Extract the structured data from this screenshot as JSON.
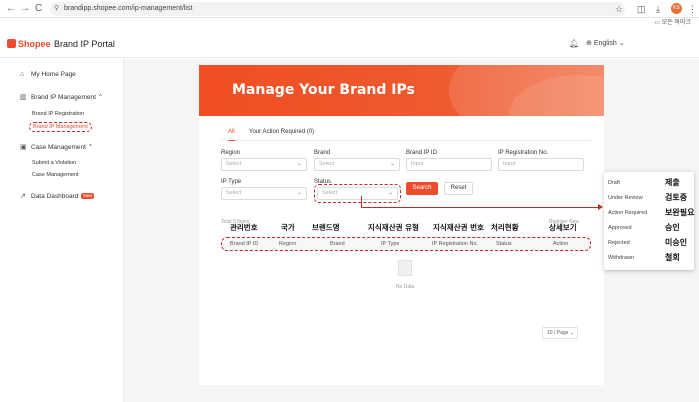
{
  "browser": {
    "url": "brandipp.shopee.com/ip-management/list",
    "back": "←",
    "forward": "→",
    "reload": "C",
    "avatar_text": "KS",
    "bookmarks_label": "모든 북마크"
  },
  "header": {
    "logo": "Shopee",
    "title": "Brand IP Portal",
    "language": "English"
  },
  "sidebar": {
    "home": "My Home Page",
    "brand_ip_management": "Brand IP Management",
    "brand_ip_registration": "Brand IP Registration",
    "brand_ip_list": "Brand IP Management",
    "case_management": "Case Management",
    "submit_violation": "Submit a Violation",
    "case_management_sub": "Case Management",
    "data_dashboard": "Data Dashboard",
    "new_badge": "New"
  },
  "main": {
    "banner_title": "Manage Your Brand IPs",
    "tabs": [
      "All",
      "Your Action Required (0)"
    ],
    "filters": {
      "region_label": "Region",
      "region_placeholder": "Select",
      "brand_label": "Brand",
      "brand_placeholder": "Select",
      "brand_ip_id_label": "Brand IP ID",
      "brand_ip_id_placeholder": "Input",
      "ip_reg_no_label": "IP Registration No.",
      "ip_reg_no_placeholder": "Input",
      "ip_type_label": "IP Type",
      "ip_type_placeholder": "Select",
      "status_label": "Status",
      "status_placeholder": "Select"
    },
    "search_button": "Search",
    "reset_button": "Reset",
    "total_items": "Total 0 Items",
    "register_new": "Register New",
    "korean_headers": [
      "관리번호",
      "국가",
      "브랜드명",
      "지식재산권 유형",
      "지식재산권 번호",
      "처리현황",
      "상세보기"
    ],
    "columns": [
      "Brand IP ID",
      "Region",
      "Brand",
      "IP Type",
      "IP Registration No.",
      "Status",
      "Action"
    ],
    "no_data": "No Data",
    "page_size": "10 / Page"
  },
  "status_popup": [
    {
      "en": "Draft",
      "ko": "제출"
    },
    {
      "en": "Under Review",
      "ko": "검토중"
    },
    {
      "en": "Action Required",
      "ko": "보완필요"
    },
    {
      "en": "Approved",
      "ko": "승인"
    },
    {
      "en": "Rejected",
      "ko": "미승인"
    },
    {
      "en": "Withdrawn",
      "ko": "철회"
    }
  ],
  "colors": {
    "brand": "#ee4d2d",
    "annotation": "#c62828"
  }
}
